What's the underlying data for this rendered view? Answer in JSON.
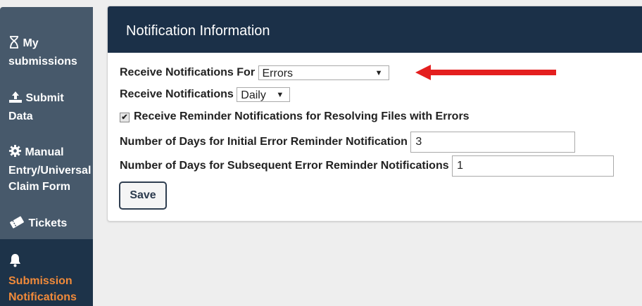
{
  "sidebar": {
    "items": [
      {
        "label_line1": "My",
        "label_line2": "submissions",
        "icon": "hourglass-icon"
      },
      {
        "label_line1": "Submit",
        "label_line2": "Data",
        "icon": "upload-icon"
      },
      {
        "label_line1": "Manual",
        "label_line2": "Entry/Universal",
        "label_line3": "Claim Form",
        "icon": "gear-icon"
      },
      {
        "label_line1": "Tickets",
        "icon": "ticket-icon"
      },
      {
        "label_line1": "Submission",
        "label_line2": "Notifications",
        "icon": "bell-icon",
        "active": true
      }
    ],
    "active_color": "#f08a3a"
  },
  "panel": {
    "title": "Notification Information",
    "receive_for_label": "Receive Notifications For",
    "receive_for_value": "Errors",
    "receive_label": "Receive Notifications",
    "receive_value": "Daily",
    "reminder_checkbox_label": "Receive Reminder Notifications for Resolving Files with Errors",
    "reminder_checked": true,
    "initial_days_label": "Number of Days for Initial Error Reminder Notification",
    "initial_days_value": "3",
    "subsequent_days_label": "Number of Days for Subsequent Error Reminder Notifications",
    "subsequent_days_value": "1",
    "save_label": "Save"
  },
  "colors": {
    "header_bg": "#1b3048",
    "sidebar_bg": "#47596b",
    "arrow": "#e41f1f"
  }
}
